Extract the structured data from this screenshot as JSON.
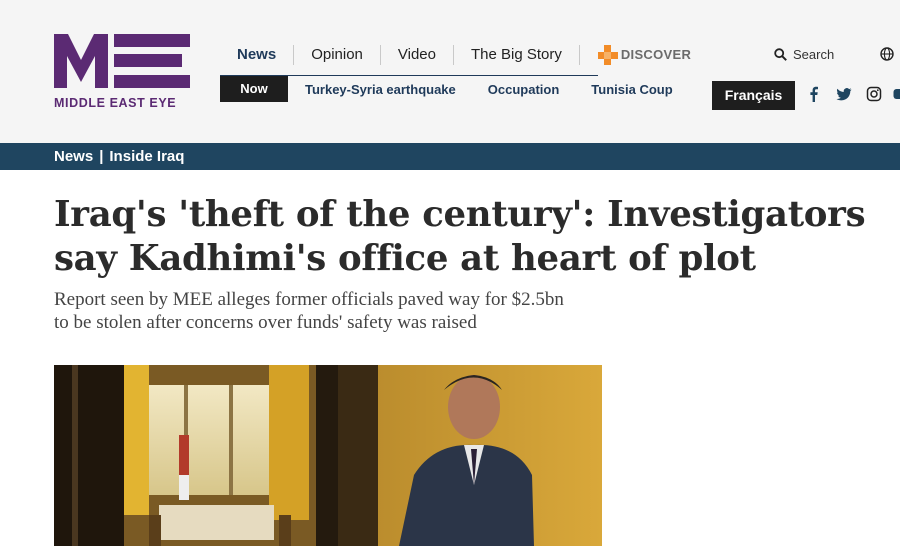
{
  "brand": {
    "name": "MIDDLE EAST EYE",
    "color": "#5b2a73"
  },
  "nav": {
    "items": [
      {
        "label": "News",
        "active": true
      },
      {
        "label": "Opinion"
      },
      {
        "label": "Video"
      },
      {
        "label": "The Big Story"
      }
    ],
    "discover_label": "DISCOVER",
    "search_label": "Search"
  },
  "subnav": {
    "now_label": "Now",
    "topics": [
      "Turkey-Syria earthquake",
      "Occupation",
      "Tunisia Coup"
    ]
  },
  "language_button": "Français",
  "social_icons": [
    "facebook-icon",
    "twitter-icon",
    "instagram-icon",
    "youtube-icon"
  ],
  "breadcrumb": {
    "section": "News",
    "subsection": "Inside Iraq"
  },
  "article": {
    "headline": "Iraq's 'theft of the century': Investigators say Kadhimi's office at heart of plot",
    "standfirst": "Report seen by MEE alleges former officials paved way for $2.5bn to be stolen after concerns over funds' safety was raised"
  },
  "colors": {
    "header_bg": "#f5f5f5",
    "nav_active": "#1f3a5a",
    "breadcrumb_bg": "#1f4560",
    "button_dark": "#1e1e1e",
    "discover_orange": "#f28c28"
  }
}
